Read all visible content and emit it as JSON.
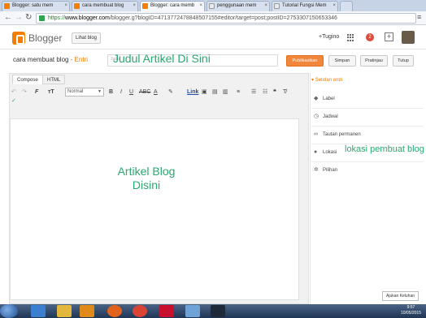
{
  "browser": {
    "tabs": [
      {
        "label": "Blogger: satu mem"
      },
      {
        "label": "cara membuat blog"
      },
      {
        "label": "Blogger: cara memb"
      },
      {
        "label": "penggunaan mem"
      },
      {
        "label": "Tutorial Fungsi Mem"
      }
    ],
    "url": {
      "scheme": "https://",
      "host": "www.blogger.com",
      "path": "/blogger.g?blogID=4713772478848507155#editor/target=post;postID=2753307150653346"
    }
  },
  "header": {
    "brand": "Blogger",
    "view_blog": "Lihat blog",
    "user": "+Tugino",
    "notif_count": "2"
  },
  "post": {
    "crumb_blog": "cara membuat blog",
    "crumb_sep": " · ",
    "crumb_entry": "Entri",
    "title_placeholder": "Judul",
    "title_annotation": "Judul Artikel Di Sini",
    "body_annotation_line1": "Artikel Blog",
    "body_annotation_line2": "Disini"
  },
  "actions": {
    "publish": "Publikasikan",
    "save": "Simpan",
    "preview": "Pratinjau",
    "close": "Tutup"
  },
  "editor": {
    "tab_compose": "Compose",
    "tab_html": "HTML",
    "font": "Normal",
    "link": "Link"
  },
  "sidebar": {
    "header": "Setelan entri",
    "items": [
      {
        "label": "Label"
      },
      {
        "label": "Jadwal"
      },
      {
        "label": "Tautan permanen"
      },
      {
        "label": "Lokasi"
      },
      {
        "label": "Pilihan"
      }
    ],
    "location_annotation": "lokasi  pembuat blog"
  },
  "help": "Ajukan Keluhan",
  "taskbar": {
    "time": "9:57",
    "date": "10/05/2015"
  },
  "colors": {
    "accent": "#f57d00",
    "annotation": "#2aa86f"
  }
}
